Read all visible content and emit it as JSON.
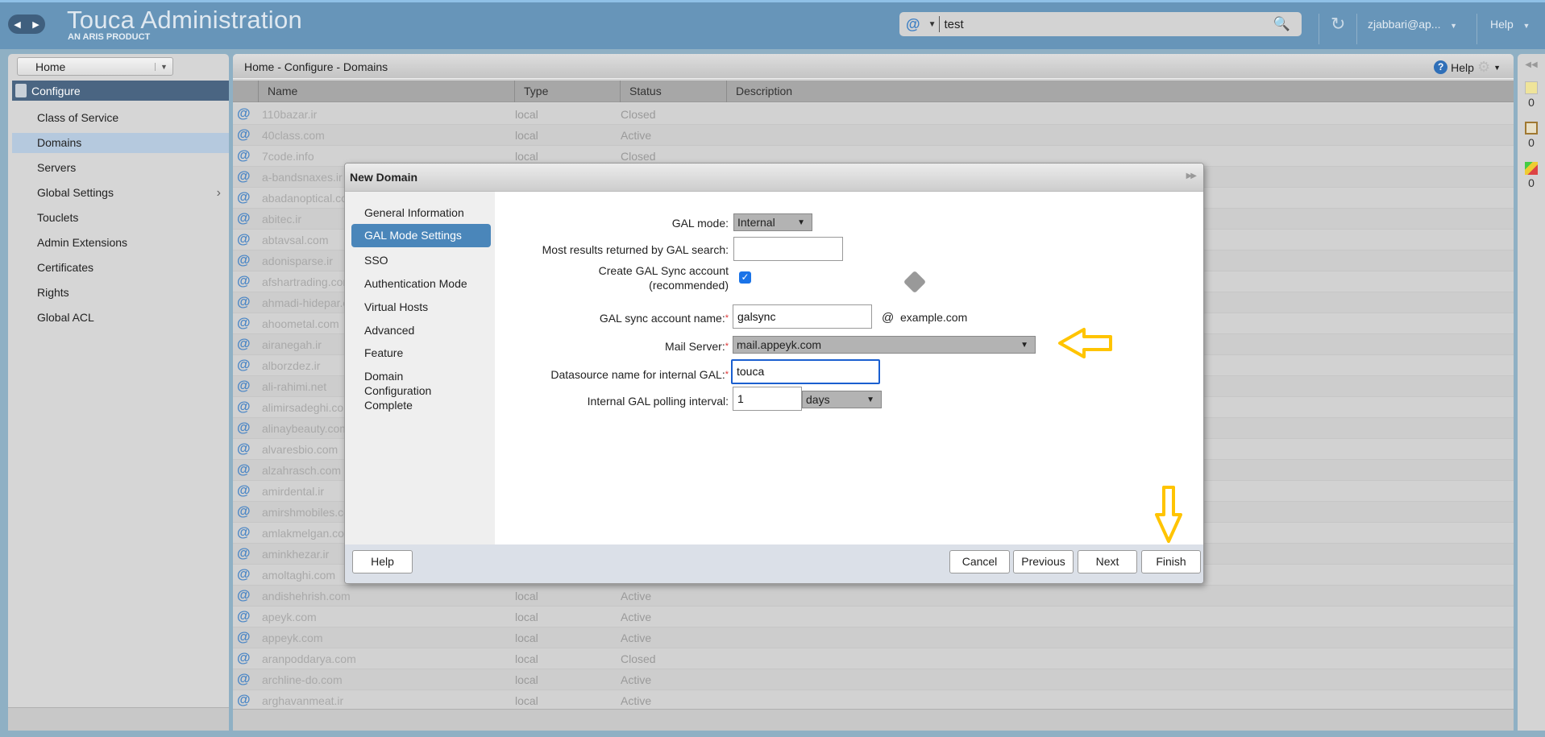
{
  "header": {
    "title": "Touca Administration",
    "subtitle": "AN ARIS PRODUCT",
    "search": {
      "type_icon": "@",
      "value": "test"
    },
    "user": "zjabbari@ap...",
    "help": "Help"
  },
  "sidebar": {
    "home": "Home",
    "section": "Configure",
    "items": [
      {
        "label": "Class of Service"
      },
      {
        "label": "Domains",
        "selected": true
      },
      {
        "label": "Servers"
      },
      {
        "label": "Global Settings",
        "has_submenu": true
      },
      {
        "label": "Touclets"
      },
      {
        "label": "Admin Extensions"
      },
      {
        "label": "Certificates"
      },
      {
        "label": "Rights"
      },
      {
        "label": "Global ACL"
      }
    ]
  },
  "main": {
    "breadcrumb": "Home - Configure - Domains",
    "help": "Help",
    "columns": [
      "Name",
      "Type",
      "Status",
      "Description"
    ],
    "rows": [
      {
        "name": "110bazar.ir",
        "type": "local",
        "status": "Closed"
      },
      {
        "name": "40class.com",
        "type": "local",
        "status": "Active"
      },
      {
        "name": "7code.info",
        "type": "local",
        "status": "Closed"
      },
      {
        "name": "a-bandsnaxes.ir"
      },
      {
        "name": "abadanoptical.com"
      },
      {
        "name": "abitec.ir"
      },
      {
        "name": "abtavsal.com"
      },
      {
        "name": "adonisparse.ir"
      },
      {
        "name": "afshartrading.com"
      },
      {
        "name": "ahmadi-hidepar.com"
      },
      {
        "name": "ahoometal.com"
      },
      {
        "name": "airanegah.ir"
      },
      {
        "name": "alborzdez.ir"
      },
      {
        "name": "ali-rahimi.net"
      },
      {
        "name": "alimirsadeghi.com"
      },
      {
        "name": "alinaybeauty.com"
      },
      {
        "name": "alvaresbio.com"
      },
      {
        "name": "alzahrasch.com"
      },
      {
        "name": "amirdental.ir"
      },
      {
        "name": "amirshmobiles.com"
      },
      {
        "name": "amlakmelgan.com"
      },
      {
        "name": "aminkhezar.ir"
      },
      {
        "name": "amoltaghi.com"
      },
      {
        "name": "andishehrish.com",
        "type": "local",
        "status": "Active"
      },
      {
        "name": "apeyk.com",
        "type": "local",
        "status": "Active"
      },
      {
        "name": "appeyk.com",
        "type": "local",
        "status": "Active"
      },
      {
        "name": "aranpoddarya.com",
        "type": "local",
        "status": "Closed"
      },
      {
        "name": "archline-do.com",
        "type": "local",
        "status": "Active"
      },
      {
        "name": "arghavanmeat.ir",
        "type": "local",
        "status": "Active"
      }
    ]
  },
  "right_strip": {
    "counts": [
      "0",
      "0",
      "0"
    ]
  },
  "dialog": {
    "title": "New Domain",
    "steps": [
      "General Information",
      "GAL Mode Settings",
      "SSO",
      "Authentication Mode",
      "Virtual Hosts",
      "Advanced",
      "Feature",
      "Domain Configuration Complete"
    ],
    "active_step": "GAL Mode Settings",
    "form": {
      "gal_mode_label": "GAL mode:",
      "gal_mode_value": "Internal",
      "max_results_label": "Most results returned by GAL search:",
      "max_results_value": "",
      "create_sync_label_1": "Create GAL Sync account",
      "create_sync_label_2": "(recommended)",
      "create_sync_checked": true,
      "sync_name_label": "GAL sync account name:",
      "sync_name_value": "galsync",
      "at": "@",
      "domain": "example.com",
      "mail_server_label": "Mail Server:",
      "mail_server_value": "mail.appeyk.com",
      "datasource_label": "Datasource name for internal GAL:",
      "datasource_value": "touca",
      "polling_label": "Internal GAL polling interval:",
      "polling_value": "1",
      "polling_unit": "days",
      "required_mark": "*"
    },
    "buttons": {
      "help": "Help",
      "cancel": "Cancel",
      "previous": "Previous",
      "next": "Next",
      "finish": "Finish"
    }
  },
  "annotation_color": "#ffc400"
}
